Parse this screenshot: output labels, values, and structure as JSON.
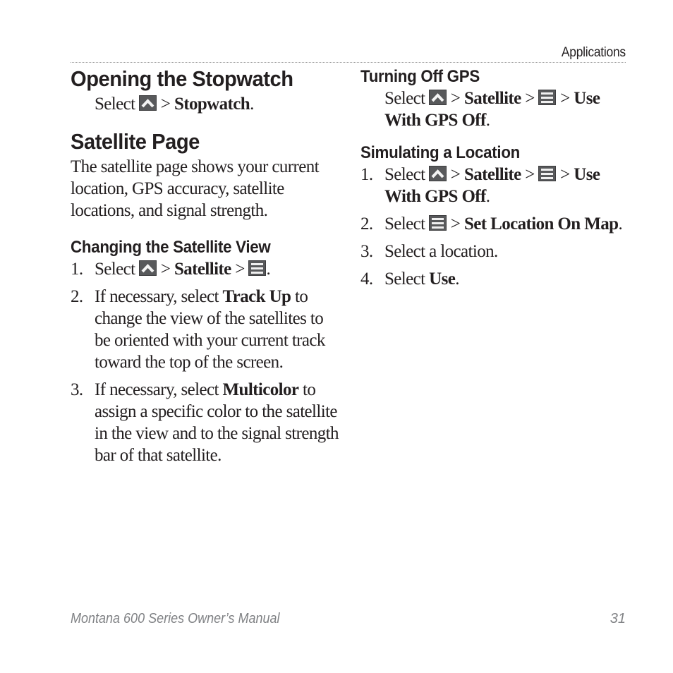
{
  "header": {
    "section": "Applications"
  },
  "left": {
    "stopwatch": {
      "title": "Opening the Stopwatch",
      "select": "Select",
      "sep": ">",
      "target": "Stopwatch",
      "end": "."
    },
    "satellite_page": {
      "title": "Satellite Page",
      "body": "The satellite page shows your current location, GPS accuracy, satellite locations, and signal strength."
    },
    "change_view": {
      "title": "Changing the Satellite View",
      "steps": [
        {
          "num": "1.",
          "select": "Select",
          "sep1": ">",
          "bold1": "Satellite",
          "sep2": ">",
          "end": "."
        },
        {
          "num": "2.",
          "pre": "If necessary, select ",
          "bold": "Track Up",
          "post": " to change the view of the satellites to be oriented with your current track toward the top of the screen."
        },
        {
          "num": "3.",
          "pre": "If necessary, select ",
          "bold": "Multicolor",
          "post": " to assign a specific color to the satellite in the view and to the signal strength bar of that satellite."
        }
      ]
    }
  },
  "right": {
    "gps_off": {
      "title": "Turning Off GPS",
      "select": "Select",
      "sep1": ">",
      "bold1": "Satellite",
      "sep2": ">",
      "sep3": ">",
      "bold2": "Use With GPS Off",
      "end": "."
    },
    "simulate": {
      "title": "Simulating a Location",
      "steps": [
        {
          "num": "1.",
          "select": "Select",
          "sep1": ">",
          "bold1": "Satellite",
          "sep2": ">",
          "sep3": ">",
          "bold2": "Use With GPS Off",
          "end": "."
        },
        {
          "num": "2.",
          "select": "Select",
          "sep1": ">",
          "bold1": "Set Location On Map",
          "end": "."
        },
        {
          "num": "3.",
          "text": "Select a location."
        },
        {
          "num": "4.",
          "select": "Select ",
          "bold1": "Use",
          "end": "."
        }
      ]
    }
  },
  "footer": {
    "manual_title": "Montana 600 Series Owner’s Manual",
    "page_number": "31"
  },
  "icons": {
    "up": "up-chevron-icon",
    "menu": "menu-icon"
  }
}
